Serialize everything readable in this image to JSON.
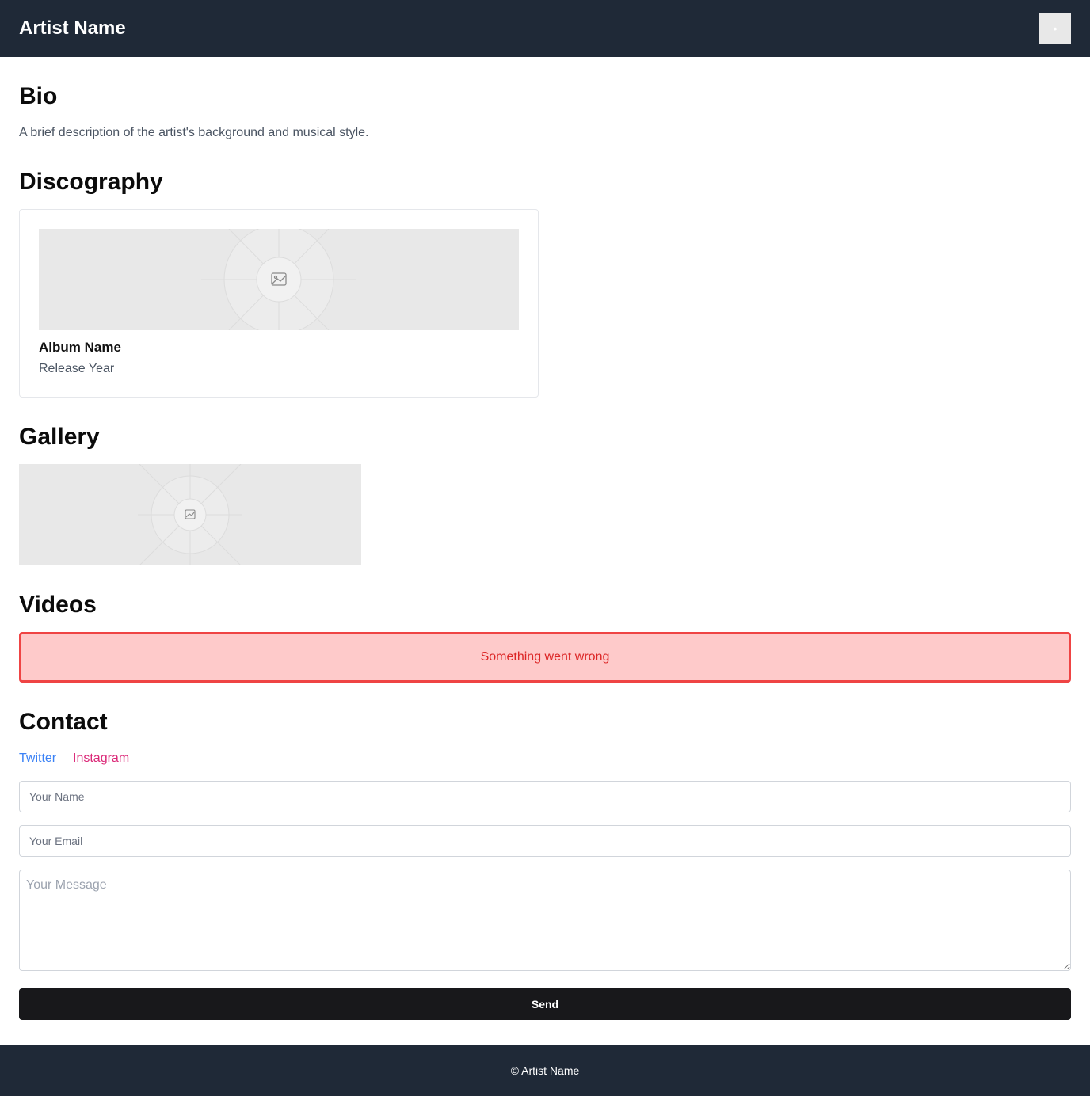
{
  "header": {
    "title": "Artist Name",
    "menu_icon": "menu-icon"
  },
  "sections": {
    "bio": {
      "heading": "Bio",
      "text": "A brief description of the artist's background and musical style."
    },
    "discography": {
      "heading": "Discography",
      "albums": [
        {
          "image_icon": "image-placeholder-icon",
          "name": "Album Name",
          "year": "Release Year"
        }
      ]
    },
    "gallery": {
      "heading": "Gallery",
      "image_icon": "image-placeholder-icon"
    },
    "videos": {
      "heading": "Videos",
      "error_message": "Something went wrong"
    },
    "contact": {
      "heading": "Contact",
      "links": [
        {
          "label": "Twitter",
          "color": "#3b82f6"
        },
        {
          "label": "Instagram",
          "color": "#db2777"
        }
      ],
      "form": {
        "name_placeholder": "Your Name",
        "email_placeholder": "Your Email",
        "message_placeholder": "Your Message",
        "send_label": "Send"
      }
    }
  },
  "footer": {
    "text": "© Artist Name"
  },
  "colors": {
    "header_bg": "#1f2937",
    "error_bg": "#fecaca",
    "error_border": "#ef4444",
    "button_bg": "#18181b"
  }
}
